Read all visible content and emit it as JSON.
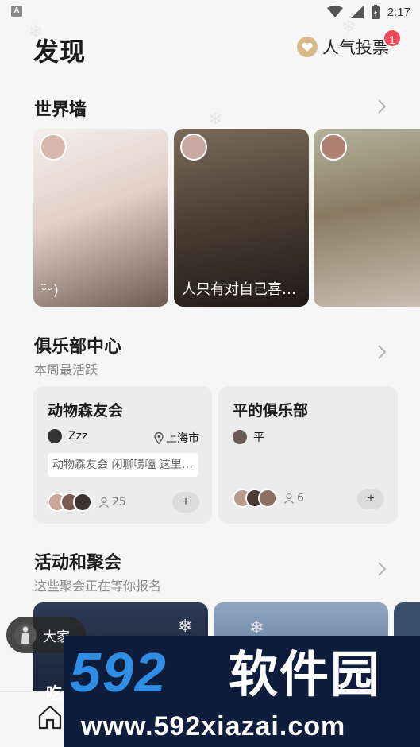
{
  "status_bar": {
    "time": "2:17",
    "notif_glyph": "A"
  },
  "header": {
    "title": "发现",
    "vote_label": "人气投票",
    "vote_badge": "1"
  },
  "world_wall": {
    "title": "世界墙",
    "cards": [
      {
        "caption": "ᵕ̈ᵕ)",
        "colors": [
          "#ece7e4",
          "#c9a999"
        ]
      },
      {
        "caption": "人只有对自己喜…",
        "colors": [
          "#5a4a3c",
          "#2b2420"
        ]
      },
      {
        "caption": "",
        "colors": [
          "#a3a48d",
          "#5b4a3d"
        ]
      }
    ]
  },
  "clubs": {
    "title": "俱乐部中心",
    "subtitle": "本周最活跃",
    "cards": [
      {
        "name": "动物森友会",
        "owner": "Zzz",
        "city": "上海市",
        "desc": "动物森友会 闲聊唠嗑  这里…",
        "members": "25",
        "join": "+"
      },
      {
        "name": "平的俱乐部",
        "owner": "平",
        "city": "",
        "desc": "",
        "members": "6",
        "join": "+"
      }
    ]
  },
  "events": {
    "title": "活动和聚会",
    "subtitle": "这些聚会正在等你报名",
    "float_label": "大家",
    "peek_text": "吃"
  },
  "watermark": {
    "brand_num": "592",
    "brand_cn": "软件园",
    "url": "www.592xiazai.com"
  }
}
